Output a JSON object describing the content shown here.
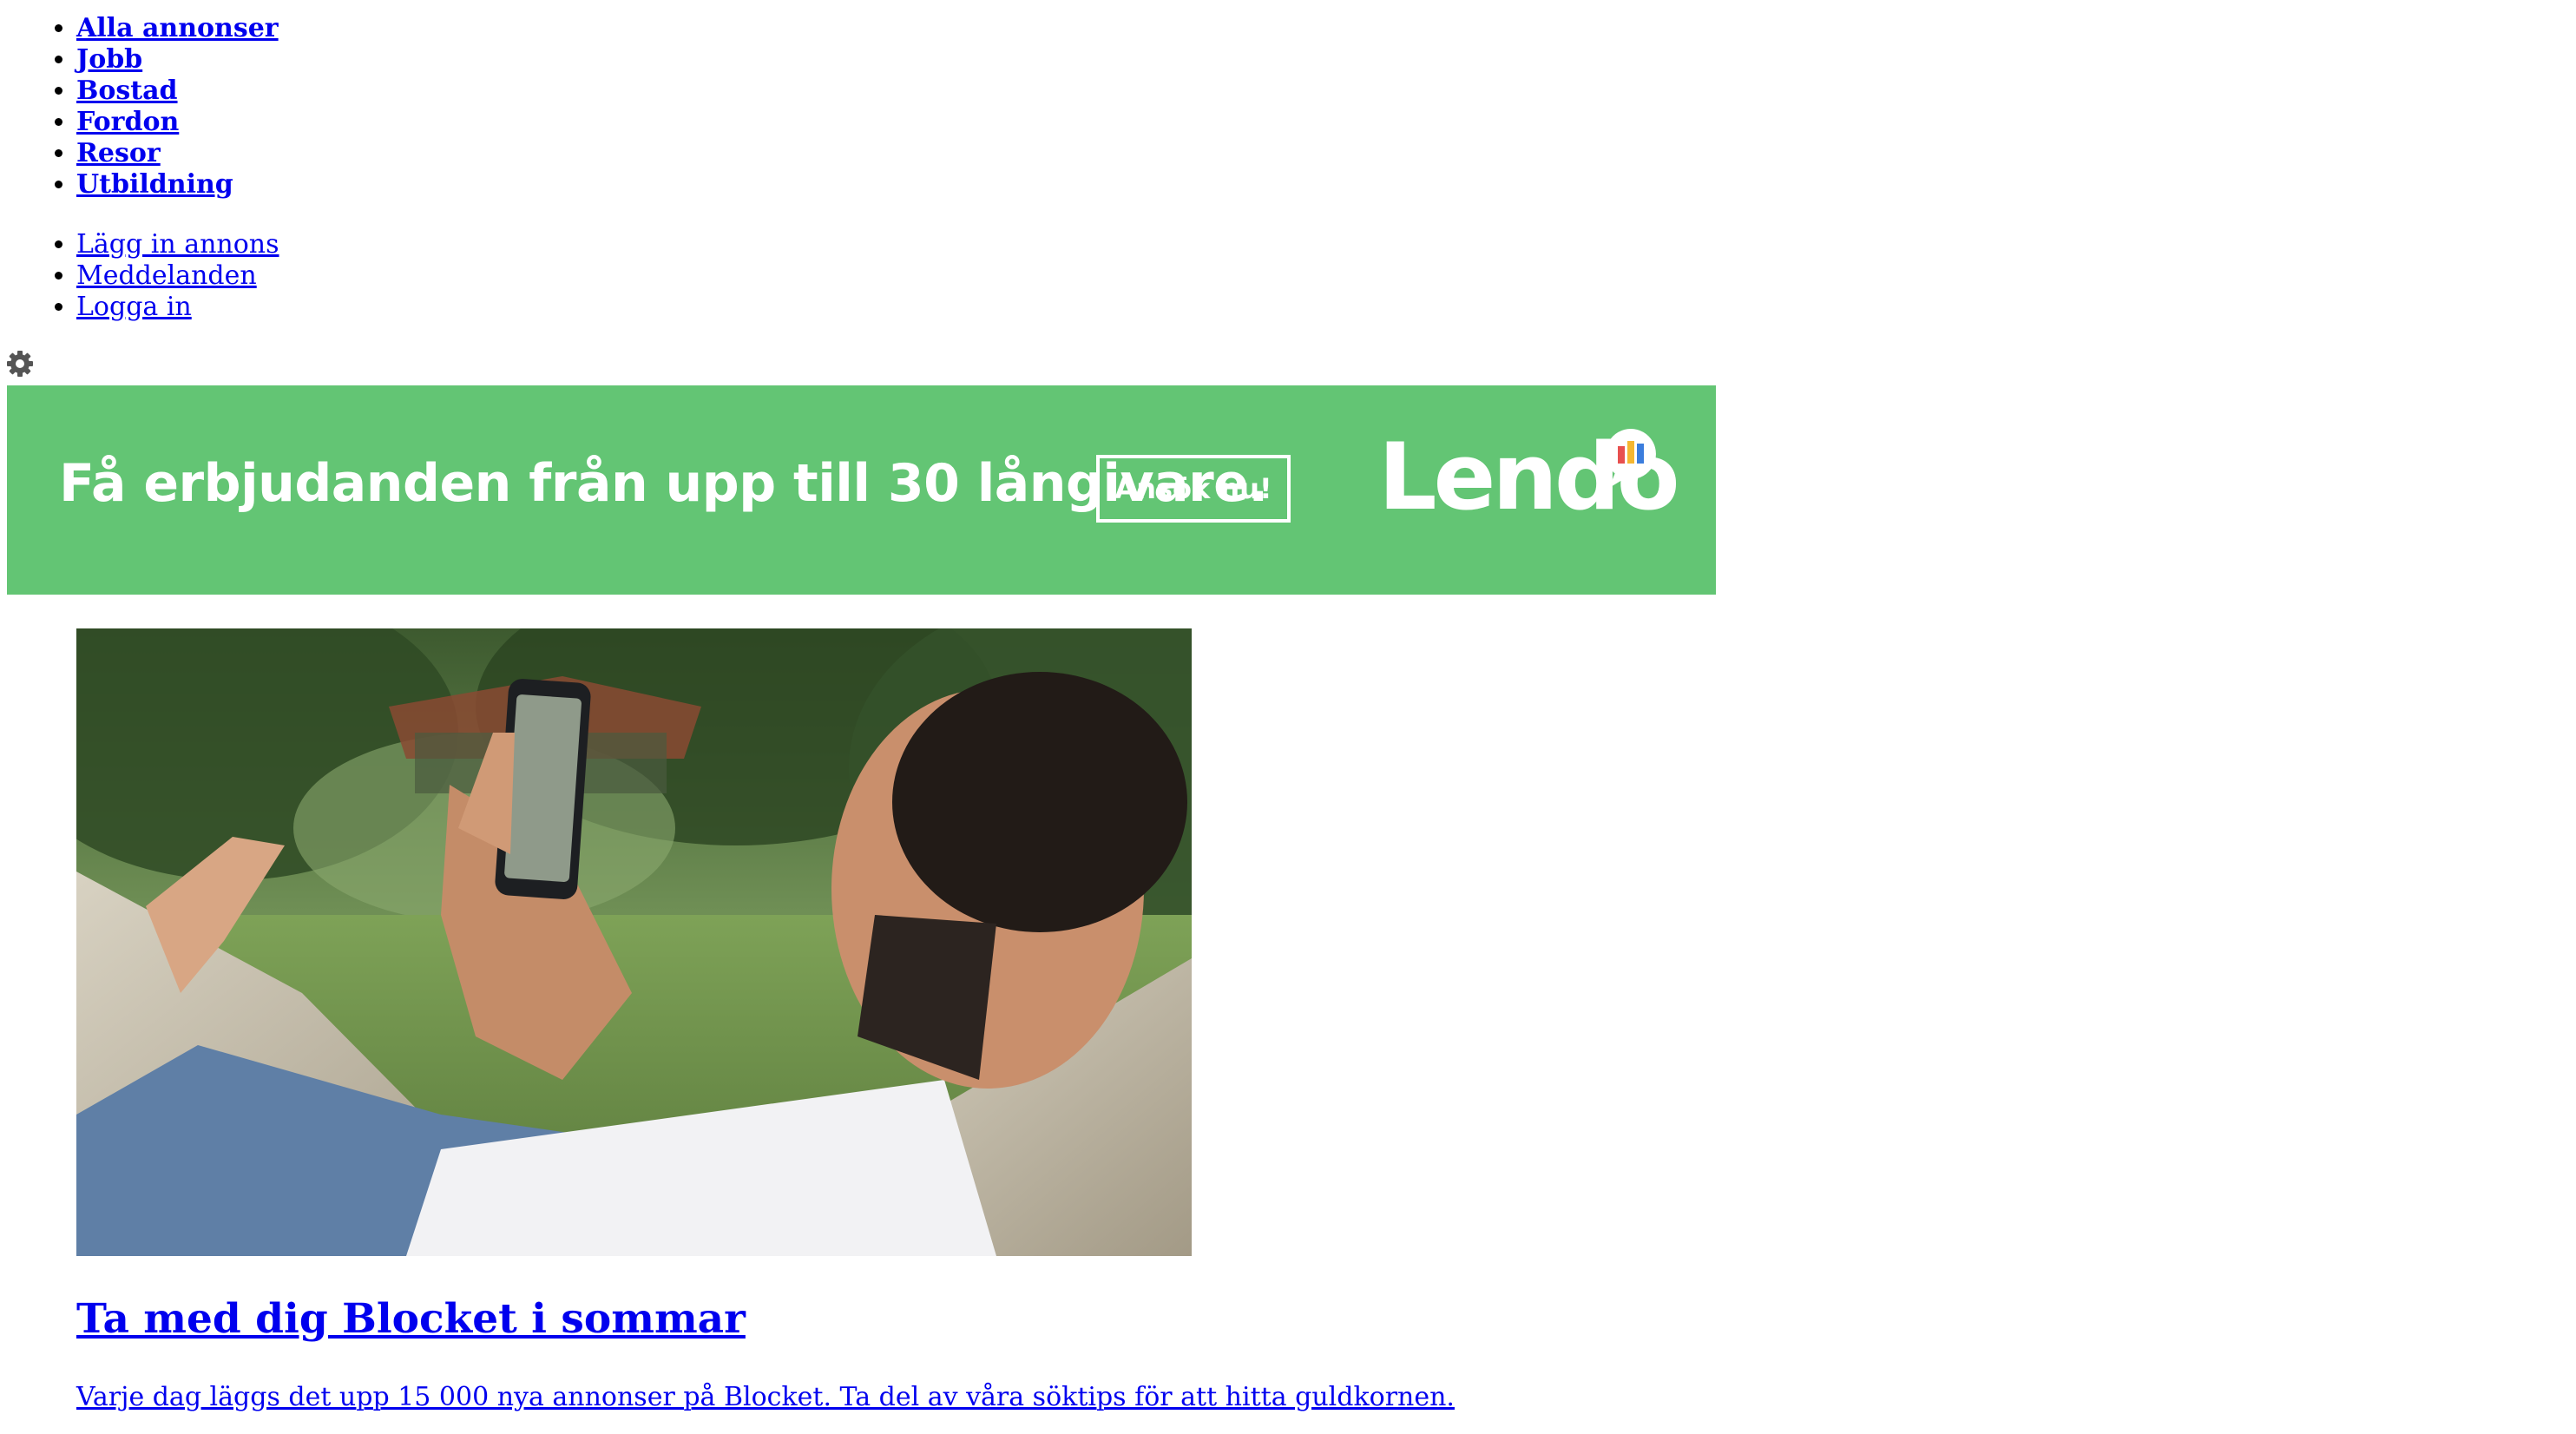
{
  "nav": {
    "categories": [
      "Alla annonser",
      "Jobb",
      "Bostad",
      "Fordon",
      "Resor",
      "Utbildning"
    ],
    "user_links": [
      "Lägg in annons",
      "Meddelanden",
      "Logga in"
    ]
  },
  "settings": {
    "icon": "gear-icon"
  },
  "banner": {
    "headline": "Få erbjudanden från upp till 30 långivare.",
    "cta": "Ansök nu!",
    "brand": "Lendo",
    "background_color": "#63c574"
  },
  "promo": {
    "title": "Ta med dig Blocket i sommar",
    "description": "Varje dag läggs det upp 15 000 nya annonser på Blocket. Ta del av våra söktips för att hitta guldkornen."
  },
  "colors": {
    "link": "#0000ee"
  }
}
